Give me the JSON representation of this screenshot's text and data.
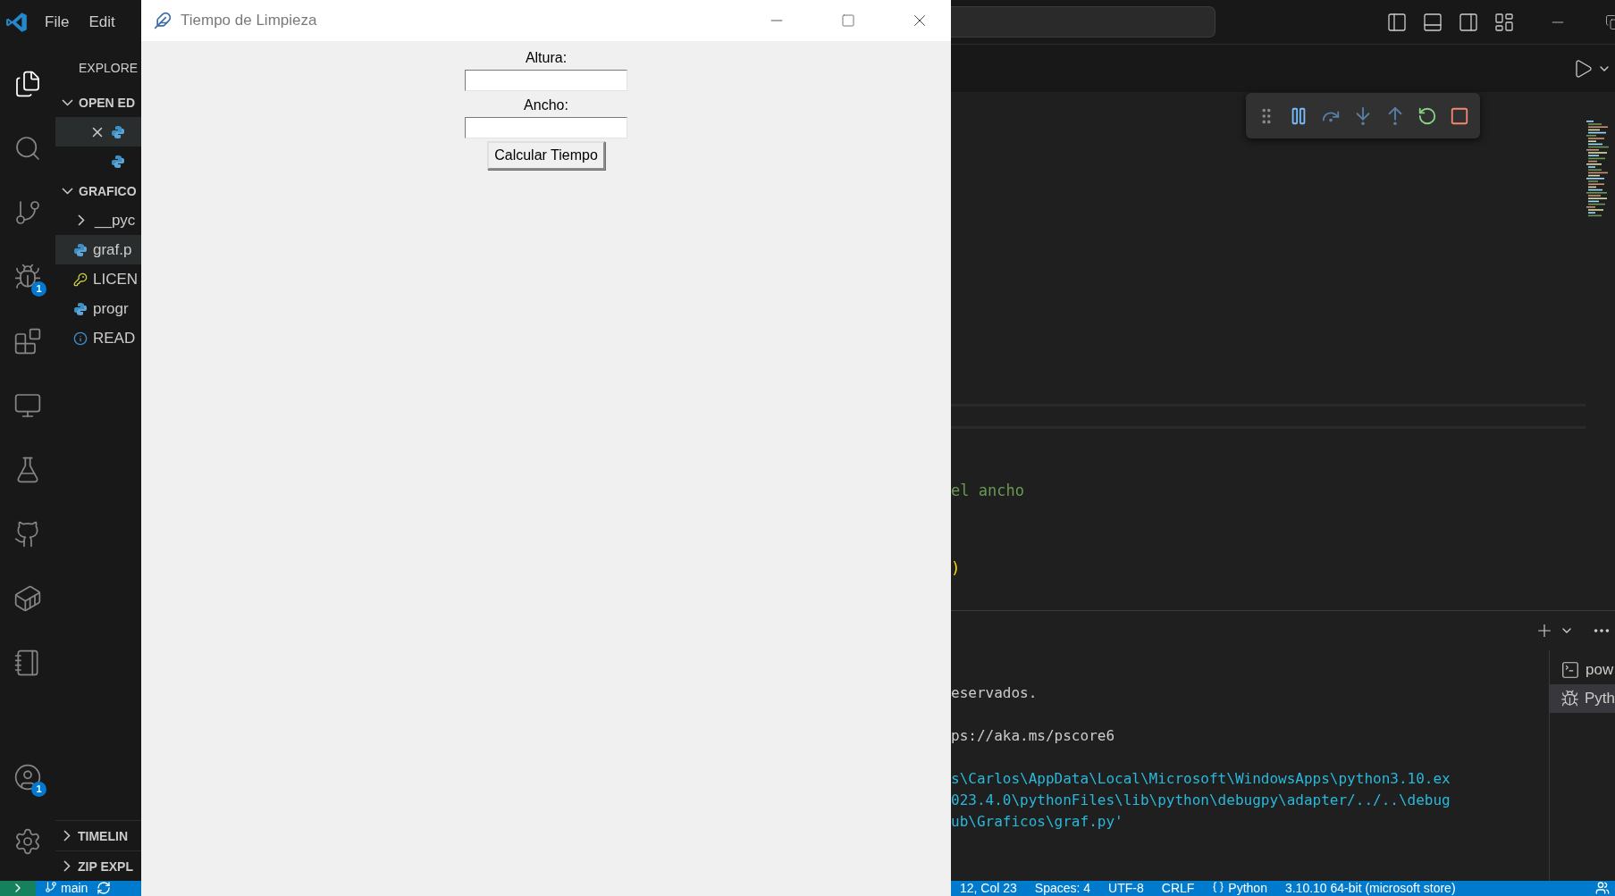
{
  "menu": [
    "File",
    "Edit"
  ],
  "activity_bar": {
    "top": [
      {
        "selected": true
      },
      {
        "selected": false
      },
      {
        "selected": false
      },
      {
        "selected": false,
        "badge": "1"
      },
      {
        "selected": false
      },
      {
        "selected": false
      },
      {
        "selected": false
      },
      {
        "selected": false
      },
      {
        "selected": false
      },
      {
        "selected": false
      }
    ],
    "bottom": [
      {
        "selected": false,
        "badge": "1"
      },
      {
        "selected": false
      }
    ]
  },
  "sidebar": {
    "title": "EXPLORE",
    "open_editors": {
      "title": "OPEN ED",
      "expanded": true,
      "items": [
        {
          "selected": true
        },
        {
          "selected": false
        }
      ]
    },
    "folder": {
      "title": "GRAFICO",
      "expanded": true,
      "items": [
        {
          "name": "__pyc",
          "kind": "folder",
          "expanded": false,
          "selected": false
        },
        {
          "name": "graf.p",
          "kind": "python",
          "selected": true
        },
        {
          "name": "LICEN",
          "kind": "license",
          "selected": false
        },
        {
          "name": "progr",
          "kind": "python",
          "selected": false
        },
        {
          "name": "READ",
          "kind": "info",
          "selected": false
        }
      ]
    },
    "bottom_sections": [
      {
        "title": "TIMELIN",
        "expanded": false
      },
      {
        "title": "ZIP EXPL",
        "expanded": false
      }
    ]
  },
  "status_left": {
    "branch": "main"
  },
  "tk_window": {
    "title": "Tiempo de Limpieza",
    "fields": [
      {
        "label": "Altura:"
      },
      {
        "label": "Ancho:"
      }
    ],
    "button": "Calcular Tiempo"
  },
  "editor": {
    "code": [
      {
        "text": "el ancho",
        "kind": "comment"
      },
      {
        "text": ")",
        "kind": "paren"
      }
    ]
  },
  "terminal": {
    "blocks": [
      {
        "kind": "plain",
        "lines": [
          "eservados."
        ]
      },
      {
        "kind": "plain",
        "lines": [
          "ps://aka.ms/pscore6"
        ]
      },
      {
        "kind": "command",
        "lines": [
          "s\\Carlos\\AppData\\Local\\Microsoft\\WindowsApps\\python3.10.ex",
          "023.4.0\\pythonFiles\\lib\\python\\debugpy\\adapter/../..\\debug",
          "ub\\Graficos\\graf.py'"
        ]
      }
    ],
    "tabs": [
      {
        "label": "pow",
        "kind": "shell",
        "selected": false
      },
      {
        "label": "Pyth",
        "kind": "debug",
        "selected": true
      }
    ]
  },
  "status_right": [
    "12, Col 23",
    "Spaces: 4",
    "UTF-8",
    "CRLF",
    "Python",
    "3.10.10 64-bit (microsoft store)"
  ]
}
